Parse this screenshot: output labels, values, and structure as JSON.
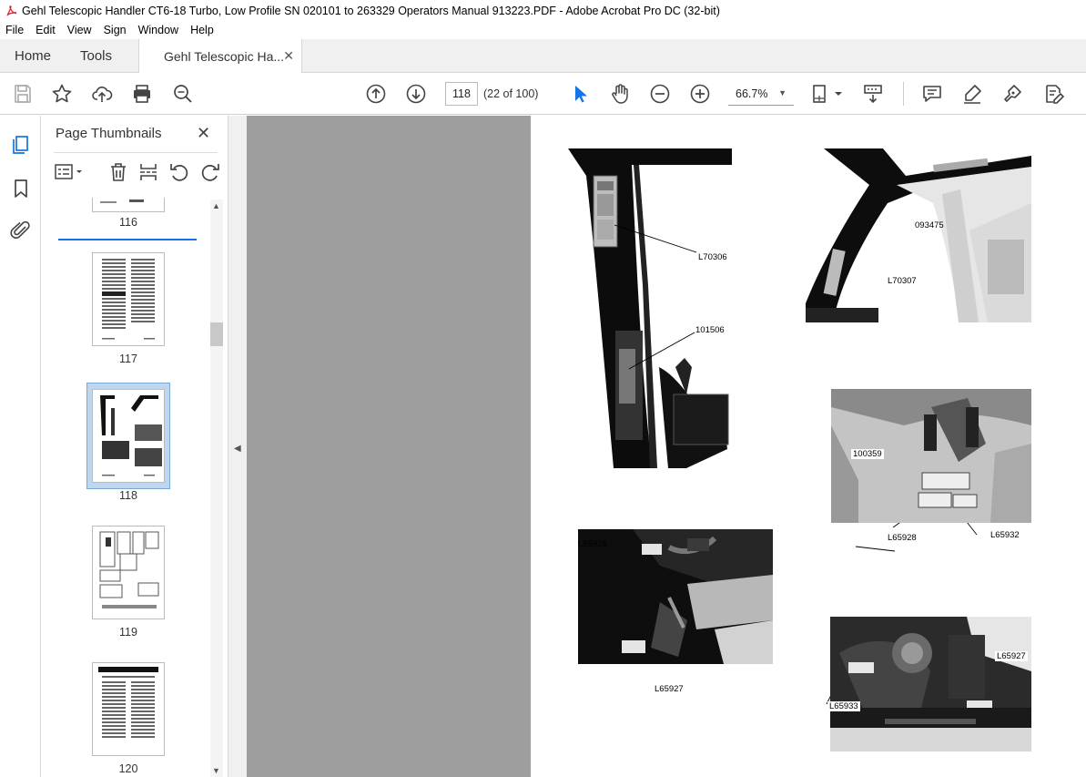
{
  "window": {
    "title": "Gehl Telescopic Handler CT6-18 Turbo, Low Profile SN 020101 to 263329 Operators Manual 913223.PDF - Adobe Acrobat Pro DC (32-bit)"
  },
  "menu": [
    "File",
    "Edit",
    "View",
    "Sign",
    "Window",
    "Help"
  ],
  "tabs": {
    "home": "Home",
    "tools": "Tools",
    "document": "Gehl Telescopic Ha..."
  },
  "toolbar": {
    "page_number": "118",
    "page_count": "(22 of 100)",
    "zoom": "66.7%"
  },
  "panel": {
    "title": "Page Thumbnails",
    "thumbnails": [
      {
        "label": "116"
      },
      {
        "label": "117"
      },
      {
        "label": "118",
        "selected": true
      },
      {
        "label": "119"
      },
      {
        "label": "120"
      }
    ]
  },
  "document_page": {
    "callouts": {
      "a1": "L70306",
      "a2": "101506",
      "b1": "093475",
      "b2": "L70307",
      "c1": "100359",
      "c2": "L65928",
      "c3": "L65932",
      "d1": "L65928",
      "d2": "L65927",
      "e1": "L65927",
      "e2": "L65933"
    }
  },
  "colors": {
    "accent": "#1473e6",
    "viewer_bg": "#9e9e9e",
    "pdf_red": "#d7282f"
  }
}
